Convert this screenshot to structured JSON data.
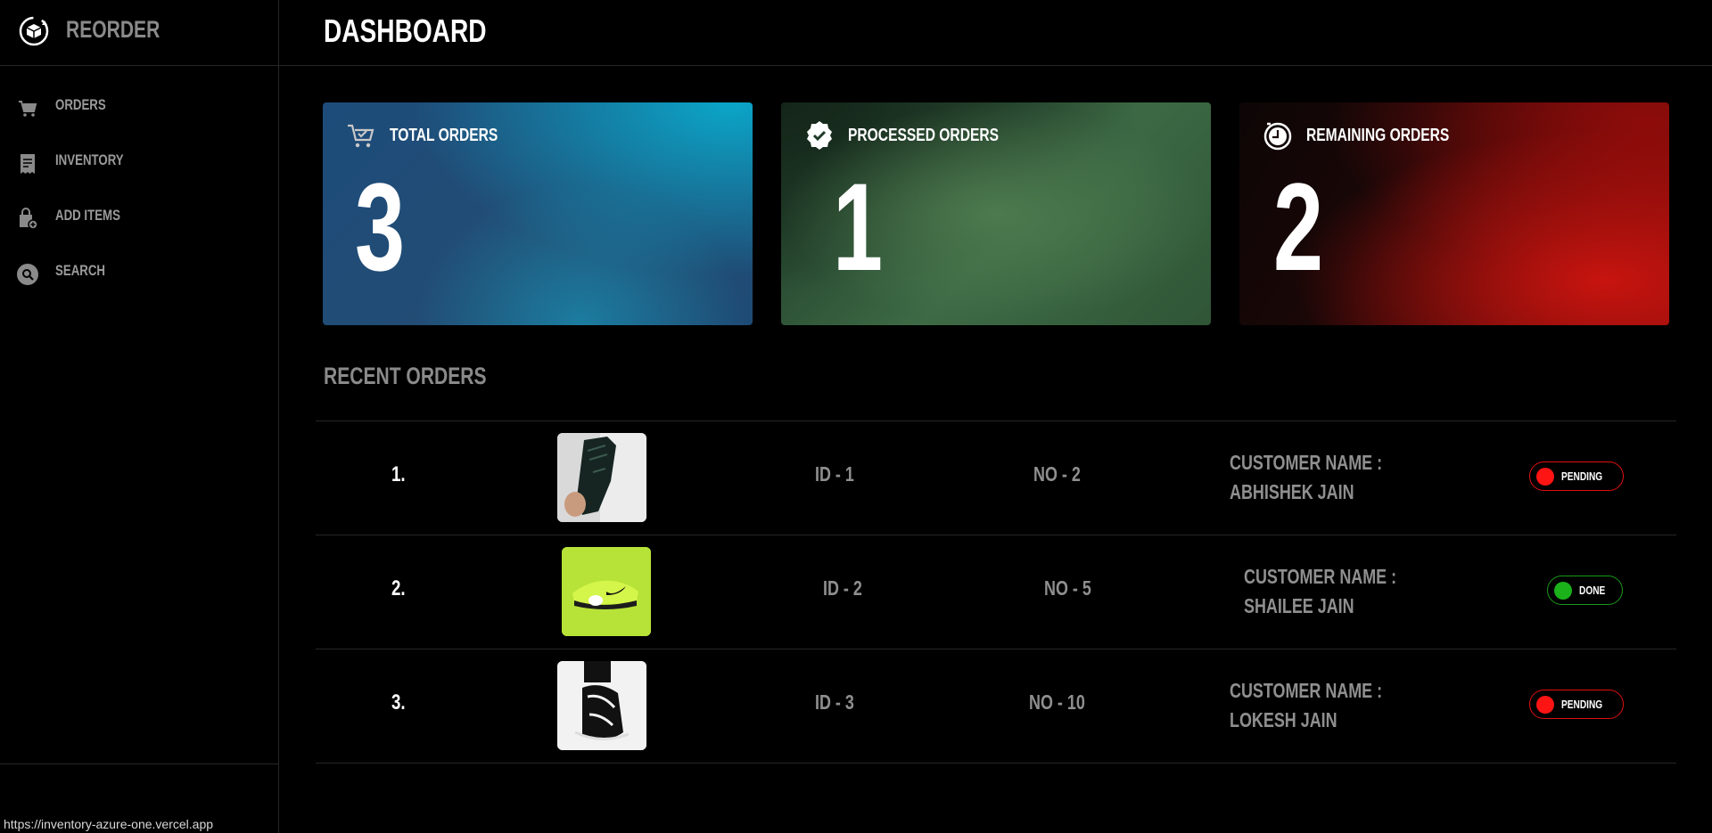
{
  "brand": {
    "name": "REORDER",
    "logo_icon": "box-refresh-icon"
  },
  "sidebar": {
    "items": [
      {
        "label": "ORDERS",
        "icon": "cart-icon"
      },
      {
        "label": "INVENTORY",
        "icon": "receipt-icon"
      },
      {
        "label": "ADD ITEMS",
        "icon": "bag-add-icon"
      },
      {
        "label": "SEARCH",
        "icon": "search-icon"
      }
    ]
  },
  "header": {
    "title": "DASHBOARD"
  },
  "stats": {
    "total": {
      "label": "TOTAL ORDERS",
      "value": "3",
      "icon": "cart-check-icon"
    },
    "processed": {
      "label": "PROCESSED ORDERS",
      "value": "1",
      "icon": "check-badge-icon"
    },
    "remaining": {
      "label": "REMAINING ORDERS",
      "value": "2",
      "icon": "clock-icon"
    }
  },
  "recent": {
    "title": "RECENT ORDERS",
    "orders": [
      {
        "num": "1.",
        "id": "ID - 1",
        "no": "NO - 2",
        "cust_label": "CUSTOMER NAME :",
        "cust_name": "ABHISHEK JAIN",
        "status": "PENDING"
      },
      {
        "num": "2.",
        "id": "ID - 2",
        "no": "NO - 5",
        "cust_label": "CUSTOMER NAME :",
        "cust_name": "SHAILEE JAIN",
        "status": "DONE"
      },
      {
        "num": "3.",
        "id": "ID - 3",
        "no": "NO - 10",
        "cust_label": "CUSTOMER NAME :",
        "cust_name": "LOKESH JAIN",
        "status": "PENDING"
      }
    ]
  },
  "status_bar": {
    "url": "https://inventory-azure-one.vercel.app"
  },
  "colors": {
    "pending": "#ff1414",
    "done": "#1bb11b",
    "muted_text": "#8f8f8f"
  }
}
